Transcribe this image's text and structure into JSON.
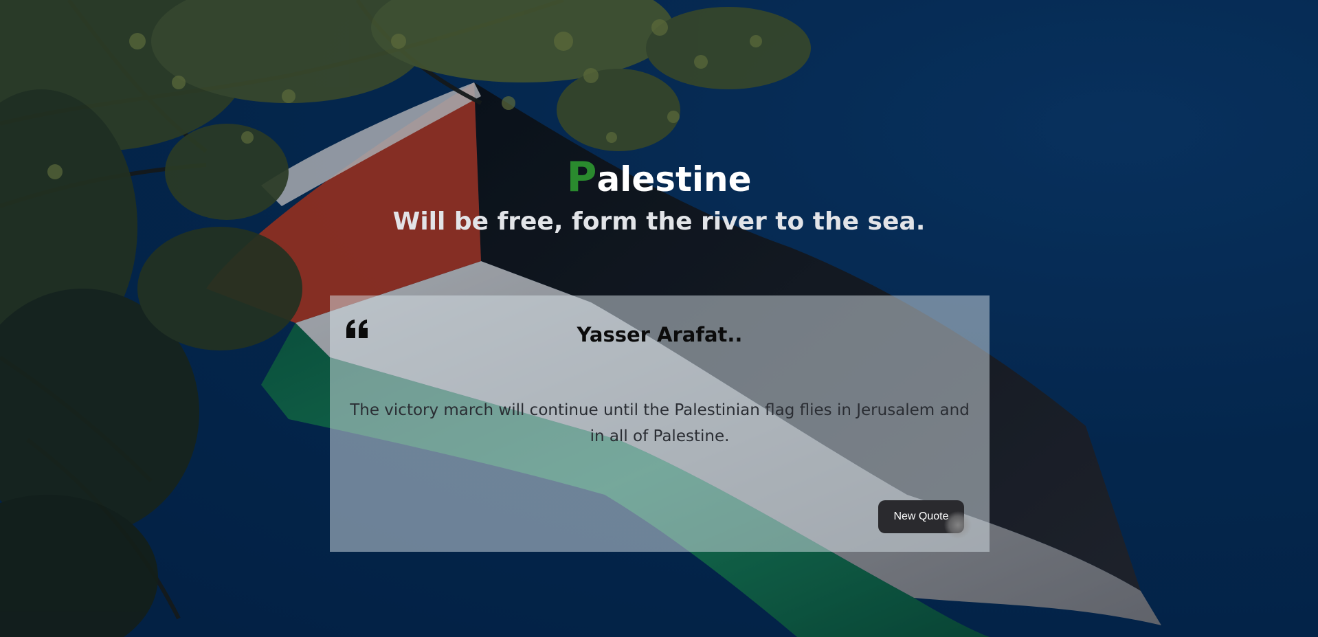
{
  "page": {
    "title_initial": "P",
    "title_rest": "alestine",
    "subtitle": "Will be free, form the river to the sea."
  },
  "quote": {
    "icon": "quote-left-icon",
    "author": "Yasser Arafat..",
    "text": "The victory march will continue until the Palestinian flag flies in Jerusalem and in all of Palestine.",
    "button_label": "New Quote"
  },
  "colors": {
    "background": "#052c57",
    "title": "#ffffff",
    "title_initial": "#2a8a2e",
    "subtitle": "#e2e4e8",
    "button": "#2a2a2e",
    "flag_red": "#c7371a",
    "flag_white": "#e6e2df",
    "flag_black": "#151515",
    "flag_green": "#0e8a4c"
  },
  "background_image": {
    "subject": "flag-of-palestine-waving-under-tree-branches"
  }
}
